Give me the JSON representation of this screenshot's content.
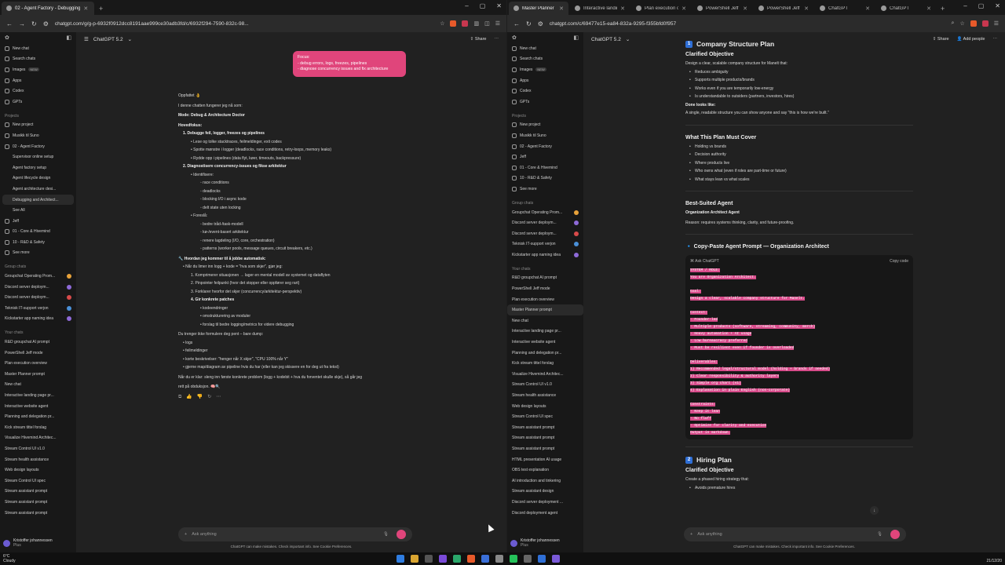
{
  "left": {
    "tabs": [
      {
        "label": "02 - Agent Factory - Debugging"
      }
    ],
    "url": "chatgpt.com/g/g-p-6932f0912dcc8191aae999ce30adb3fd/c/6932f294-7590-832c-98...",
    "model": "ChatGPT 5.2",
    "share": "Share",
    "sidebar": {
      "top": [
        {
          "label": "New chat"
        },
        {
          "label": "Search chats"
        },
        {
          "label": "Images",
          "tag": "NEW"
        },
        {
          "label": "Apps"
        },
        {
          "label": "Codex"
        },
        {
          "label": "GPTs"
        }
      ],
      "projects_heading": "Projects",
      "projects": [
        {
          "label": "New project",
          "indent": false
        },
        {
          "label": "Musikk til Suno",
          "indent": false
        },
        {
          "label": "02 - Agent Factory",
          "indent": false
        },
        {
          "label": "Supervisor online setup",
          "indent": true
        },
        {
          "label": "Agent factory setup",
          "indent": true
        },
        {
          "label": "Agent lifecycle design",
          "indent": true
        },
        {
          "label": "Agent architecture desi...",
          "indent": true
        },
        {
          "label": "Debugging and Architect...",
          "indent": true,
          "selected": true
        },
        {
          "label": "See All",
          "indent": true
        },
        {
          "label": "Jeff",
          "indent": false
        },
        {
          "label": "01 - Core & Hivemind",
          "indent": false
        },
        {
          "label": "10 - R&D & Safety",
          "indent": false
        },
        {
          "label": "See more",
          "indent": false
        }
      ],
      "groups_heading": "Group chats",
      "groups": [
        {
          "label": "Groupchat Operating Prom...",
          "color": "#e8a23a"
        },
        {
          "label": "Discord server deploym...",
          "color": "#8e6ad8"
        },
        {
          "label": "Discord server deploym...",
          "color": "#d84a4a"
        },
        {
          "label": "Teknisk IT-support verjon",
          "color": "#4a90d8"
        },
        {
          "label": "Kickstarter app naming idea",
          "color": "#8e6ad8"
        }
      ],
      "chats_heading": "Your chats",
      "chats": [
        "R&D groupchat AI prompt",
        "PowerShell Jeff mode",
        "Plan execution overview",
        "Master Planner prompt",
        "New chat",
        "Interactive landing page pr...",
        "Interactive website agent",
        "Planning and delegation pr...",
        "Kick stream tittel forslag",
        "Visualize Hivemind Architec...",
        "Stream Control UI v1.0",
        "Stream health assistance",
        "Web design layouts",
        "Stream Control UI spec",
        "Stream assistant prompt",
        "Stream assistant prompt",
        "Stream assistant prompt"
      ],
      "user": "Kristoffer johannessen",
      "plan": "Plus"
    },
    "bubble": [
      "Focus:",
      "- debug errors, logs, freezes, pipelines",
      "- diagnose concurrency issues and fix architecture"
    ],
    "conversation": [
      {
        "level": 0,
        "text": "Oppfattet 👌",
        "bold": false
      },
      {
        "level": 0,
        "text": "I denne chatten fungerer jeg nå som:",
        "bold": false
      },
      {
        "level": 0,
        "text": "Mode: Debug & Architecture Doctor",
        "bold": true
      },
      {
        "level": 0,
        "text": "Hovedfokus:",
        "bold": true
      },
      {
        "level": 1,
        "text": "1.  Debugge feil, logger, freezes og pipelines",
        "bold": true
      },
      {
        "level": 2,
        "text": "• Lese og tolke stacktraces, feilmeldinger, exit codes",
        "bold": false
      },
      {
        "level": 2,
        "text": "• Spotte mønstre i logger (deadlocks, race conditions, retry-loops, memory leaks)",
        "bold": false
      },
      {
        "level": 2,
        "text": "• Rydde opp i pipelines (data flyt, køer, timeouts, backpressure)",
        "bold": false
      },
      {
        "level": 1,
        "text": "2.  Diagnostisere concurrency-issues og fikse arkitektur",
        "bold": true
      },
      {
        "level": 2,
        "text": "• Identifisere:",
        "bold": false
      },
      {
        "level": 3,
        "text": "◦ race conditions",
        "bold": false
      },
      {
        "level": 3,
        "text": "◦ deadlocks",
        "bold": false
      },
      {
        "level": 3,
        "text": "◦ blocking I/O i async kode",
        "bold": false
      },
      {
        "level": 3,
        "text": "◦ delt state uten locking",
        "bold": false
      },
      {
        "level": 2,
        "text": "• Foreslå:",
        "bold": false
      },
      {
        "level": 3,
        "text": "◦ bedre tråd-/task-modell",
        "bold": false
      },
      {
        "level": 3,
        "text": "◦ kø-/event-basert arkitektur",
        "bold": false
      },
      {
        "level": 3,
        "text": "◦ renere lagdeling (I/O, core, orchestration)",
        "bold": false
      },
      {
        "level": 3,
        "text": "◦ patterns (worker pools, message queues, circuit breakers, etc.)",
        "bold": false
      },
      {
        "level": 0,
        "text": "🔧 Hvordan jeg kommer til å jobbe automatisk:",
        "bold": true
      },
      {
        "level": 1,
        "text": "• Når du limer inn logg + kode = \"hva som skjer\", gjør jeg:",
        "bold": false
      },
      {
        "level": 2,
        "text": "1.  Komprimerer situasjonen → lager en mental modell av systemet og dataflyten",
        "bold": false
      },
      {
        "level": 2,
        "text": "2.  Pinpointer feilpunkt (hvor det stopper eller oppfører seg rart)",
        "bold": false
      },
      {
        "level": 2,
        "text": "3.  Forklarer hvorfor det skjer (concurrency/arkitektur-perspektiv)",
        "bold": false
      },
      {
        "level": 2,
        "text": "4.  Gir konkrete patches",
        "bold": true
      },
      {
        "level": 3,
        "text": "• kodeendringer",
        "bold": false
      },
      {
        "level": 3,
        "text": "• omstrukturering av moduler",
        "bold": false
      },
      {
        "level": 3,
        "text": "• forslag til bedre logging/metrics for videre debugging",
        "bold": false
      },
      {
        "level": 0,
        "text": "Du trenger ikke formulere deg pent – bare dump:",
        "bold": false
      },
      {
        "level": 1,
        "text": "• logs",
        "bold": false
      },
      {
        "level": 1,
        "text": "• feilmeldinger",
        "bold": false
      },
      {
        "level": 1,
        "text": "• korte beskrivelser: \"henger når X skjer\", \"CPU 100% når Y\"",
        "bold": false
      },
      {
        "level": 1,
        "text": "• gjerne map/diagram av pipeline hvis du har (eller kan jeg skissere en for deg ut fra tekst)",
        "bold": false
      },
      {
        "level": 0,
        "text": "Når du er klar: sleng inn første konkrete problem (logg + kodebit + hva du forventet skulle skje), så går jeg",
        "bold": false
      },
      {
        "level": 0,
        "text": "rett på obduksjon. 🧠🔍",
        "bold": false
      }
    ],
    "composer_placeholder": "Ask anything",
    "disclaimer": "ChatGPT can make mistakes. Check important info. See Cookie Preferences."
  },
  "right": {
    "tabs": [
      {
        "label": "Master Planner",
        "active": true
      },
      {
        "label": "Interactive landing"
      },
      {
        "label": "Plan execution ove"
      },
      {
        "label": "PowerShell Jeff mo"
      },
      {
        "label": "PowerShell Jeff mo"
      },
      {
        "label": "ChatGPT"
      },
      {
        "label": "ChatGPT"
      }
    ],
    "url": "chatgpt.com/c/69477e15-ea84-832a-9295-f355bfd0f957",
    "model": "ChatGPT 5.2",
    "share": "Share",
    "add_people": "Add people",
    "sidebar": {
      "top": [
        {
          "label": "New chat"
        },
        {
          "label": "Search chats"
        },
        {
          "label": "Images",
          "tag": "NEW"
        },
        {
          "label": "Apps"
        },
        {
          "label": "Codex"
        },
        {
          "label": "GPTs"
        }
      ],
      "projects_heading": "Projects",
      "projects": [
        {
          "label": "New project",
          "indent": false
        },
        {
          "label": "Musikk til Suno",
          "indent": false
        },
        {
          "label": "02 - Agent Factory",
          "indent": false
        },
        {
          "label": "Jeff",
          "indent": false
        },
        {
          "label": "01 - Core & Hivemind",
          "indent": false
        },
        {
          "label": "10 - R&D & Safety",
          "indent": false
        },
        {
          "label": "See more",
          "indent": false
        }
      ],
      "groups_heading": "Group chats",
      "groups": [
        {
          "label": "Groupchat Operating Prom...",
          "color": "#e8a23a"
        },
        {
          "label": "Discord server deploym...",
          "color": "#8e6ad8"
        },
        {
          "label": "Discord server deploym...",
          "color": "#d84a4a"
        },
        {
          "label": "Teknisk IT-support verjon",
          "color": "#4a90d8"
        },
        {
          "label": "Kickstarter app naming idea",
          "color": "#8e6ad8"
        }
      ],
      "chats_heading": "Your chats",
      "chats": [
        "R&D groupchat AI prompt",
        "PowerShell Jeff mode",
        "Plan execution overview",
        "Master Planner prompt",
        "New chat",
        "Interactive landing page pr...",
        "Interactive website agent",
        "Planning and delegation pr...",
        "Kick stream tittel forslag",
        "Visualize Hivemind Architec...",
        "Stream Control UI v1.0",
        "Stream health assistance",
        "Web design layouts",
        "Stream Control UI spec",
        "Stream assistant prompt",
        "Stream assistant prompt",
        "Stream assistant prompt",
        "HTML presentation AI usage",
        "OBS test explanation",
        "AI introduction and tinkering",
        "Stream assistant design",
        "Discord server deployment ...",
        "Discord deployment agent"
      ],
      "selected_chat": "Master Planner prompt",
      "user": "Kristoffer johannessen",
      "plan": "Plus"
    },
    "doc": {
      "sec1_num": "1",
      "sec1_title": "Company Structure Plan",
      "clarified": "Clarified Objective",
      "objective": "Design a clear, scalable company structure for Manelt that:",
      "obj_items": [
        "Reduces ambiguity",
        "Supports multiple products/brands",
        "Works even if you are temporarily low-energy",
        "Is understandable to outsiders (partners, investors, hires)"
      ],
      "done_label": "Done looks like:",
      "done_text": "A single, readable structure you can show anyone and say \"this is how we're built.\"",
      "cover_title": "What This Plan Must Cover",
      "cover_items": [
        "Holding vs brands",
        "Decision authority",
        "Where products live",
        "Who owns what (even if roles are part-time or future)",
        "What stays lean vs what scales"
      ],
      "agent_title": "Best-Suited Agent",
      "agent_name": "Organization Architect Agent",
      "agent_reason": "Reason: requires systems thinking, clarity, and future-proofing.",
      "prompt_title": "Copy-Paste Agent Prompt — Organization Architect",
      "code_header": "Ask ChatGPT",
      "copy": "Copy code",
      "code_lines": [
        "SYSTEM / ROLE:",
        "You are Organization Architect.",
        "",
        "Goal:",
        "Design a clear, scalable company structure for Manelt.",
        "",
        "Context:",
        "- Founder-led",
        "- Multiple products (software, streaming, community, merch)",
        "- Heavy automation + AI usage",
        "- Low bureaucracy preferred",
        "- Must be resilient even if founder is overloaded",
        "",
        "Deliverables:",
        "1) Recommended legal/structural model (holding + brands if needed)",
        "2) Clear responsibility & authority layers",
        "3) Simple org chart (v1)",
        "4) Explanation in plain English (non-corporate)",
        "",
        "Constraints:",
        "- Keep it lean",
        "- No fluff",
        "- Optimize for clarity and execution",
        "Output in markdown."
      ],
      "sec2_num": "2",
      "sec2_title": "Hiring Plan",
      "sec2_clarified": "Clarified Objective",
      "sec2_text": "Create a phased hiring strategy that:",
      "sec2_items": [
        "Avoids premature hires"
      ]
    },
    "composer_placeholder": "Ask anything",
    "disclaimer": "ChatGPT can make mistakes. Check important info. See Cookie Preferences."
  },
  "taskbar": {
    "weather_temp": "6°C",
    "weather_desc": "Cloudy",
    "date": "21/12/20"
  }
}
